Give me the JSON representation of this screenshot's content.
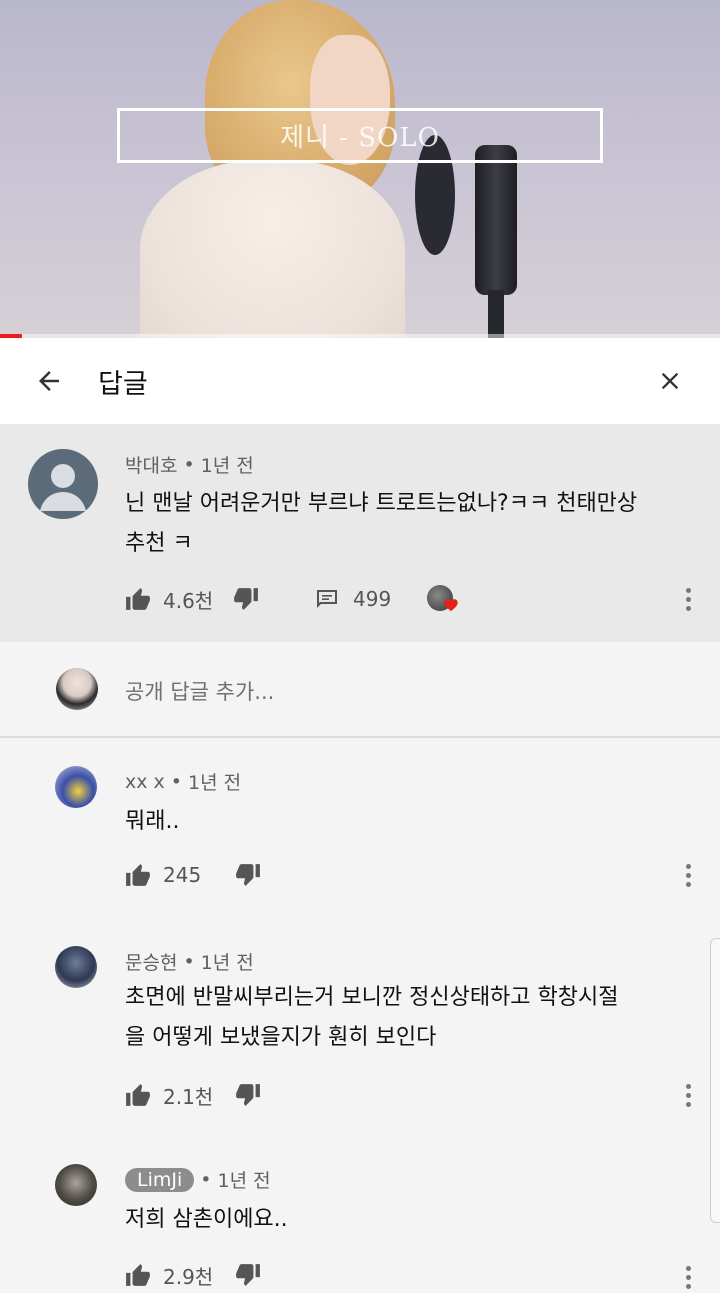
{
  "video": {
    "overlay_title": "제니 - SOLO",
    "progress": 0.03,
    "accent": "#e62117"
  },
  "header": {
    "back_icon": "arrow-left-icon",
    "title": "답글",
    "close_icon": "close-icon"
  },
  "top_comment": {
    "author": "박대호",
    "time": "1년 전",
    "text_line1": "닌 맨날 어려운거만 부르냐 트로트는없나?ㅋㅋ 천태만상",
    "text_line2": "추천 ㅋ",
    "likes": "4.6천",
    "replies": "499",
    "creator_heart": "heart-badge-icon",
    "heart_color": "#e62117"
  },
  "add_reply": {
    "placeholder": "공개 답글 추가..."
  },
  "replies": [
    {
      "author": "xx x",
      "time": "1년 전",
      "text_line1": "뭐래..",
      "text_line2": "",
      "likes": "245"
    },
    {
      "author": "문승현",
      "time": "1년 전",
      "text_line1": "초면에 반말씨부리는거 보니깐 정신상태하고 학창시절",
      "text_line2": "을 어떻게 보냈을지가 훤히 보인다",
      "likes": "2.1천"
    },
    {
      "author": "LimJi",
      "time": "1년 전",
      "text_line1": "저희 삼촌이에요..",
      "text_line2": "",
      "likes": "2.9천",
      "author_is_channel_pill": true
    }
  ]
}
